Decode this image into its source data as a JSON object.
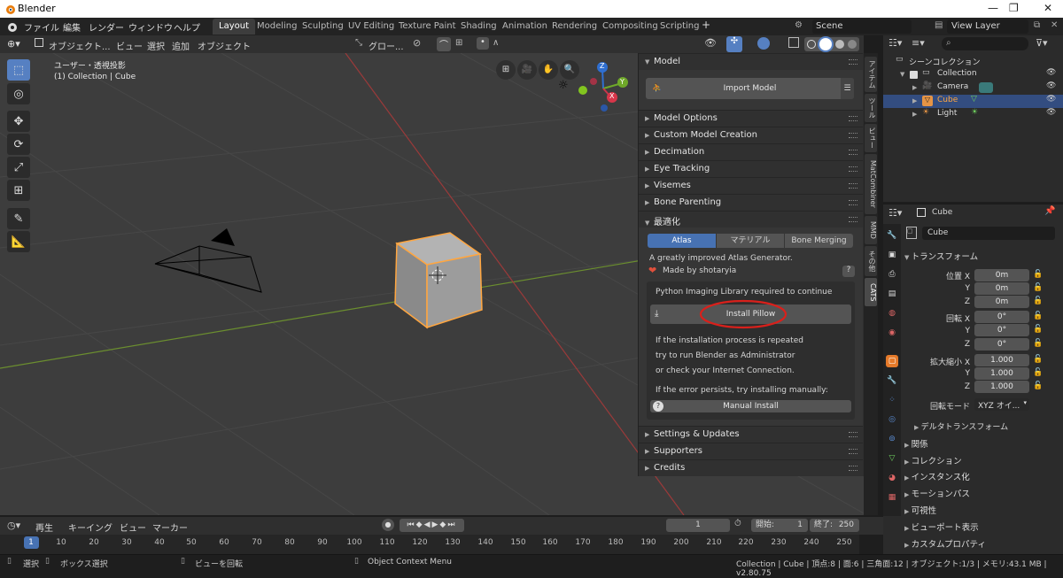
{
  "window": {
    "title": "Blender",
    "controls": [
      "—",
      "❐",
      "✕"
    ]
  },
  "menu": [
    "ファイル",
    "編集",
    "レンダー",
    "ウィンドウ",
    "ヘルプ"
  ],
  "workspace_tabs": [
    "Layout",
    "Modeling",
    "Sculpting",
    "UV Editing",
    "Texture Paint",
    "Shading",
    "Animation",
    "Rendering",
    "Compositing",
    "Scripting"
  ],
  "add_workspace": "+",
  "scene": {
    "name": "Scene",
    "view_layer": "View Layer"
  },
  "viewport_header": {
    "mode": "オブジェクト...",
    "menus": [
      "ビュー",
      "選択",
      "追加",
      "オブジェクト"
    ],
    "orientation": "グロー..."
  },
  "viewport": {
    "view_name": "ユーザー・透視投影",
    "collection_info": "(1) Collection | Cube"
  },
  "gizmo": {
    "z": "Z",
    "y": "Y",
    "x": "X"
  },
  "cats": {
    "model_header": "Model",
    "import_button": "Import Model",
    "sections_top": [
      "Model Options",
      "Custom Model Creation",
      "Decimation",
      "Eye Tracking",
      "Visemes",
      "Bone Parenting"
    ],
    "optimize_header": "最適化",
    "tabs": [
      "Atlas",
      "マテリアル",
      "Bone Merging"
    ],
    "atlas_desc": "A greatly improved Atlas Generator.",
    "made_by": "Made by shotaryia",
    "help_icon": "?",
    "pil_required": "Python Imaging Library required to continue",
    "install_pillow": "Install Pillow",
    "repeat_1": "If the installation process is repeated",
    "repeat_2": "try to run Blender as Administrator",
    "repeat_3": "or check your Internet Connection.",
    "persists": "If the error persists, try installing manually:",
    "manual_install": "Manual Install",
    "sections_bottom": [
      "Settings & Updates",
      "Supporters",
      "Credits"
    ]
  },
  "side_tabs": [
    "アイテム",
    "ツール",
    "ビュー",
    "MatCombiner",
    "MMD",
    "その他",
    "CATS"
  ],
  "outliner": {
    "scene_collection": "シーンコレクション",
    "rows": [
      {
        "name": "Collection"
      },
      {
        "name": "Camera"
      },
      {
        "name": "Cube"
      },
      {
        "name": "Light"
      }
    ]
  },
  "properties": {
    "object_name": "Cube",
    "name_field": "Cube",
    "transform_header": "トランスフォーム",
    "location_label": "位置",
    "rotation_label": "回転",
    "scale_label": "拡大縮小",
    "axes": [
      "X",
      "Y",
      "Z"
    ],
    "location": [
      "0m",
      "0m",
      "0m"
    ],
    "rotation": [
      "0°",
      "0°",
      "0°"
    ],
    "scale": [
      "1.000",
      "1.000",
      "1.000"
    ],
    "rotation_mode_label": "回転モード",
    "rotation_mode": "XYZ オイ...",
    "delta_transform": "デルタトランスフォーム",
    "sections": [
      "関係",
      "コレクション",
      "インスタンス化",
      "モーションパス",
      "可視性",
      "ビューポート表示",
      "カスタムプロパティ"
    ]
  },
  "timeline": {
    "menus": [
      "再生",
      "キーイング",
      "ビュー",
      "マーカー"
    ],
    "current_frame": "1",
    "start_label": "開始:",
    "start": "1",
    "end_label": "終了:",
    "end": "250",
    "ticks": [
      "1",
      "10",
      "20",
      "30",
      "40",
      "50",
      "60",
      "70",
      "80",
      "90",
      "100",
      "110",
      "120",
      "130",
      "140",
      "150",
      "160",
      "170",
      "180",
      "190",
      "200",
      "210",
      "220",
      "230",
      "240",
      "250"
    ]
  },
  "status": {
    "select": "選択",
    "box_select": "ボックス選択",
    "rotate_view": "ビューを回転",
    "context_menu": "Object Context Menu",
    "stats": "Collection | Cube | 頂点:8 | 面:6 | 三角面:12 | オブジェクト:1/3 | メモリ:43.1 MB | v2.80.75"
  },
  "colors": {
    "accent": "#5680c2",
    "selected": "#ffa640",
    "annotation": "#d9201b",
    "heart": "#e0503c"
  }
}
